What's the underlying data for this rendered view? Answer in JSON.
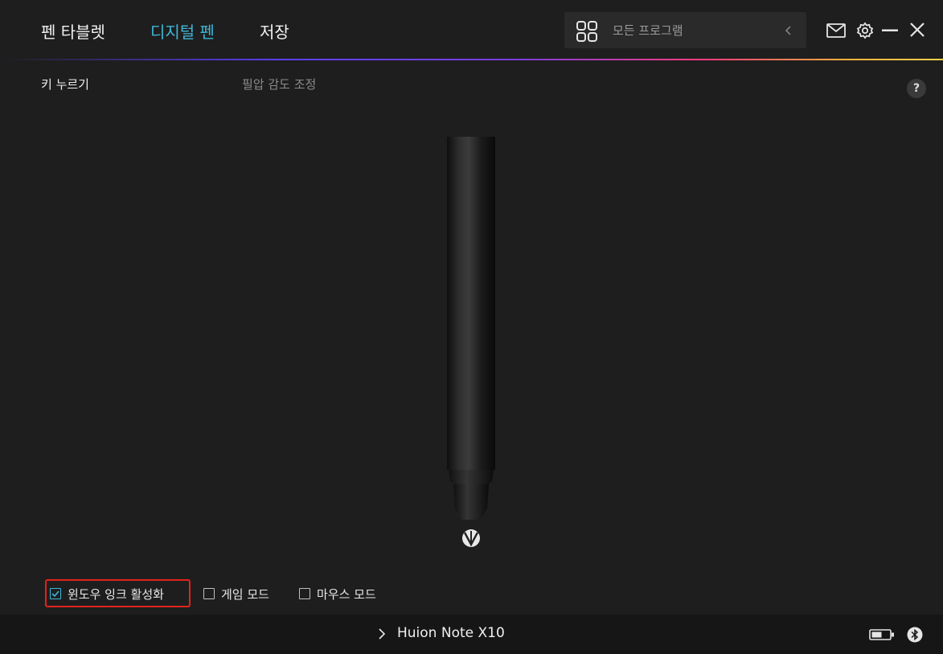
{
  "nav": {
    "tabs": [
      {
        "label": "펜 타블렛",
        "active": false
      },
      {
        "label": "디지털 펜",
        "active": true
      },
      {
        "label": "저장",
        "active": false
      }
    ],
    "accent_color": "#3fb6d8"
  },
  "program_selector": {
    "icon": "grid-icon",
    "label": "모든 프로그램",
    "chevron": "chevron-left-icon"
  },
  "window_controls": {
    "icons": [
      "mail-icon",
      "gear-icon",
      "minimize-icon",
      "close-icon"
    ]
  },
  "subtabs": [
    {
      "label": "키 누르기",
      "active": true
    },
    {
      "label": "필압 감도 조정",
      "active": false
    }
  ],
  "help": {
    "label": "?"
  },
  "options": [
    {
      "label": "윈도우 잉크 활성화",
      "checked": true,
      "highlighted": true
    },
    {
      "label": "게임 모드",
      "checked": false
    },
    {
      "label": "마우스 모드",
      "checked": false
    }
  ],
  "highlight_color": "#e0231d",
  "statusbar": {
    "device_name": "Huion Note X10",
    "icons": [
      "battery-icon",
      "bluetooth-icon"
    ]
  }
}
